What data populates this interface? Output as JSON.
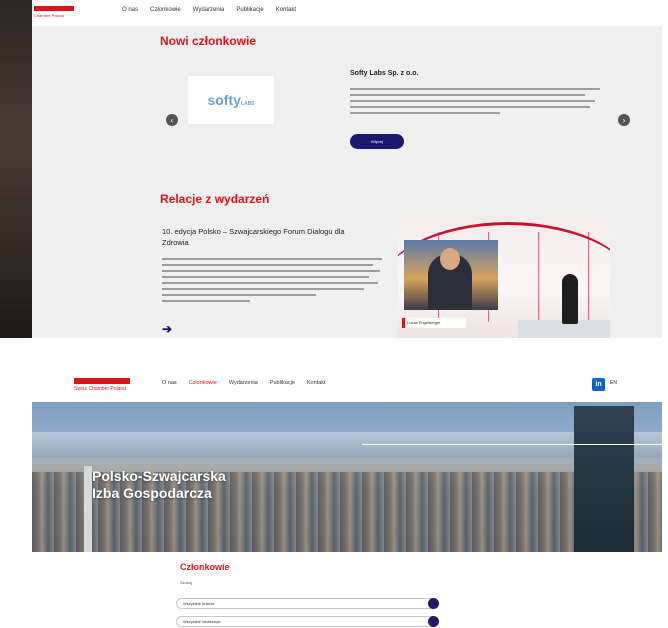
{
  "top_site": {
    "logo_text": "Chamber Poland",
    "nav": [
      "O nas",
      "Członkowie",
      "Wydarzenia",
      "Publikacje",
      "Kontakt"
    ],
    "section_new_members": "Nowi członkowie",
    "featured_company": {
      "logo_text": "softy",
      "logo_suffix": "LABS",
      "name": "Softy Labs Sp. z o.o.",
      "button_label": "Więcej"
    },
    "section_events": "Relacje z wydarzeń",
    "event": {
      "title": "10. edycja Polsko – Szwajcarskiego Forum Dialogu dla Zdrowia",
      "nameplate": "Lukas Engelberger",
      "arrow": "➔"
    }
  },
  "bottom_site": {
    "logo_brand": "Swiss",
    "logo_text": "Chamber Poland",
    "nav": [
      "O nas",
      "Członkowie",
      "Wydarzenia",
      "Publikacje",
      "Kontakt"
    ],
    "active_nav": "Członkowie",
    "linkedin": "in",
    "language": "EN",
    "hero_title_line1": "Polsko-Szwajcarska",
    "hero_title_line2": "Izba Gospodarcza",
    "section_title": "Członkowie",
    "filter_label": "Szukaj",
    "select1": "Wszystkie branże",
    "select2": "Wszystkie lokalizacje"
  },
  "colors": {
    "brand_red": "#d9151b",
    "navy": "#1d1a6e",
    "linkedin_blue": "#0a66c2"
  }
}
